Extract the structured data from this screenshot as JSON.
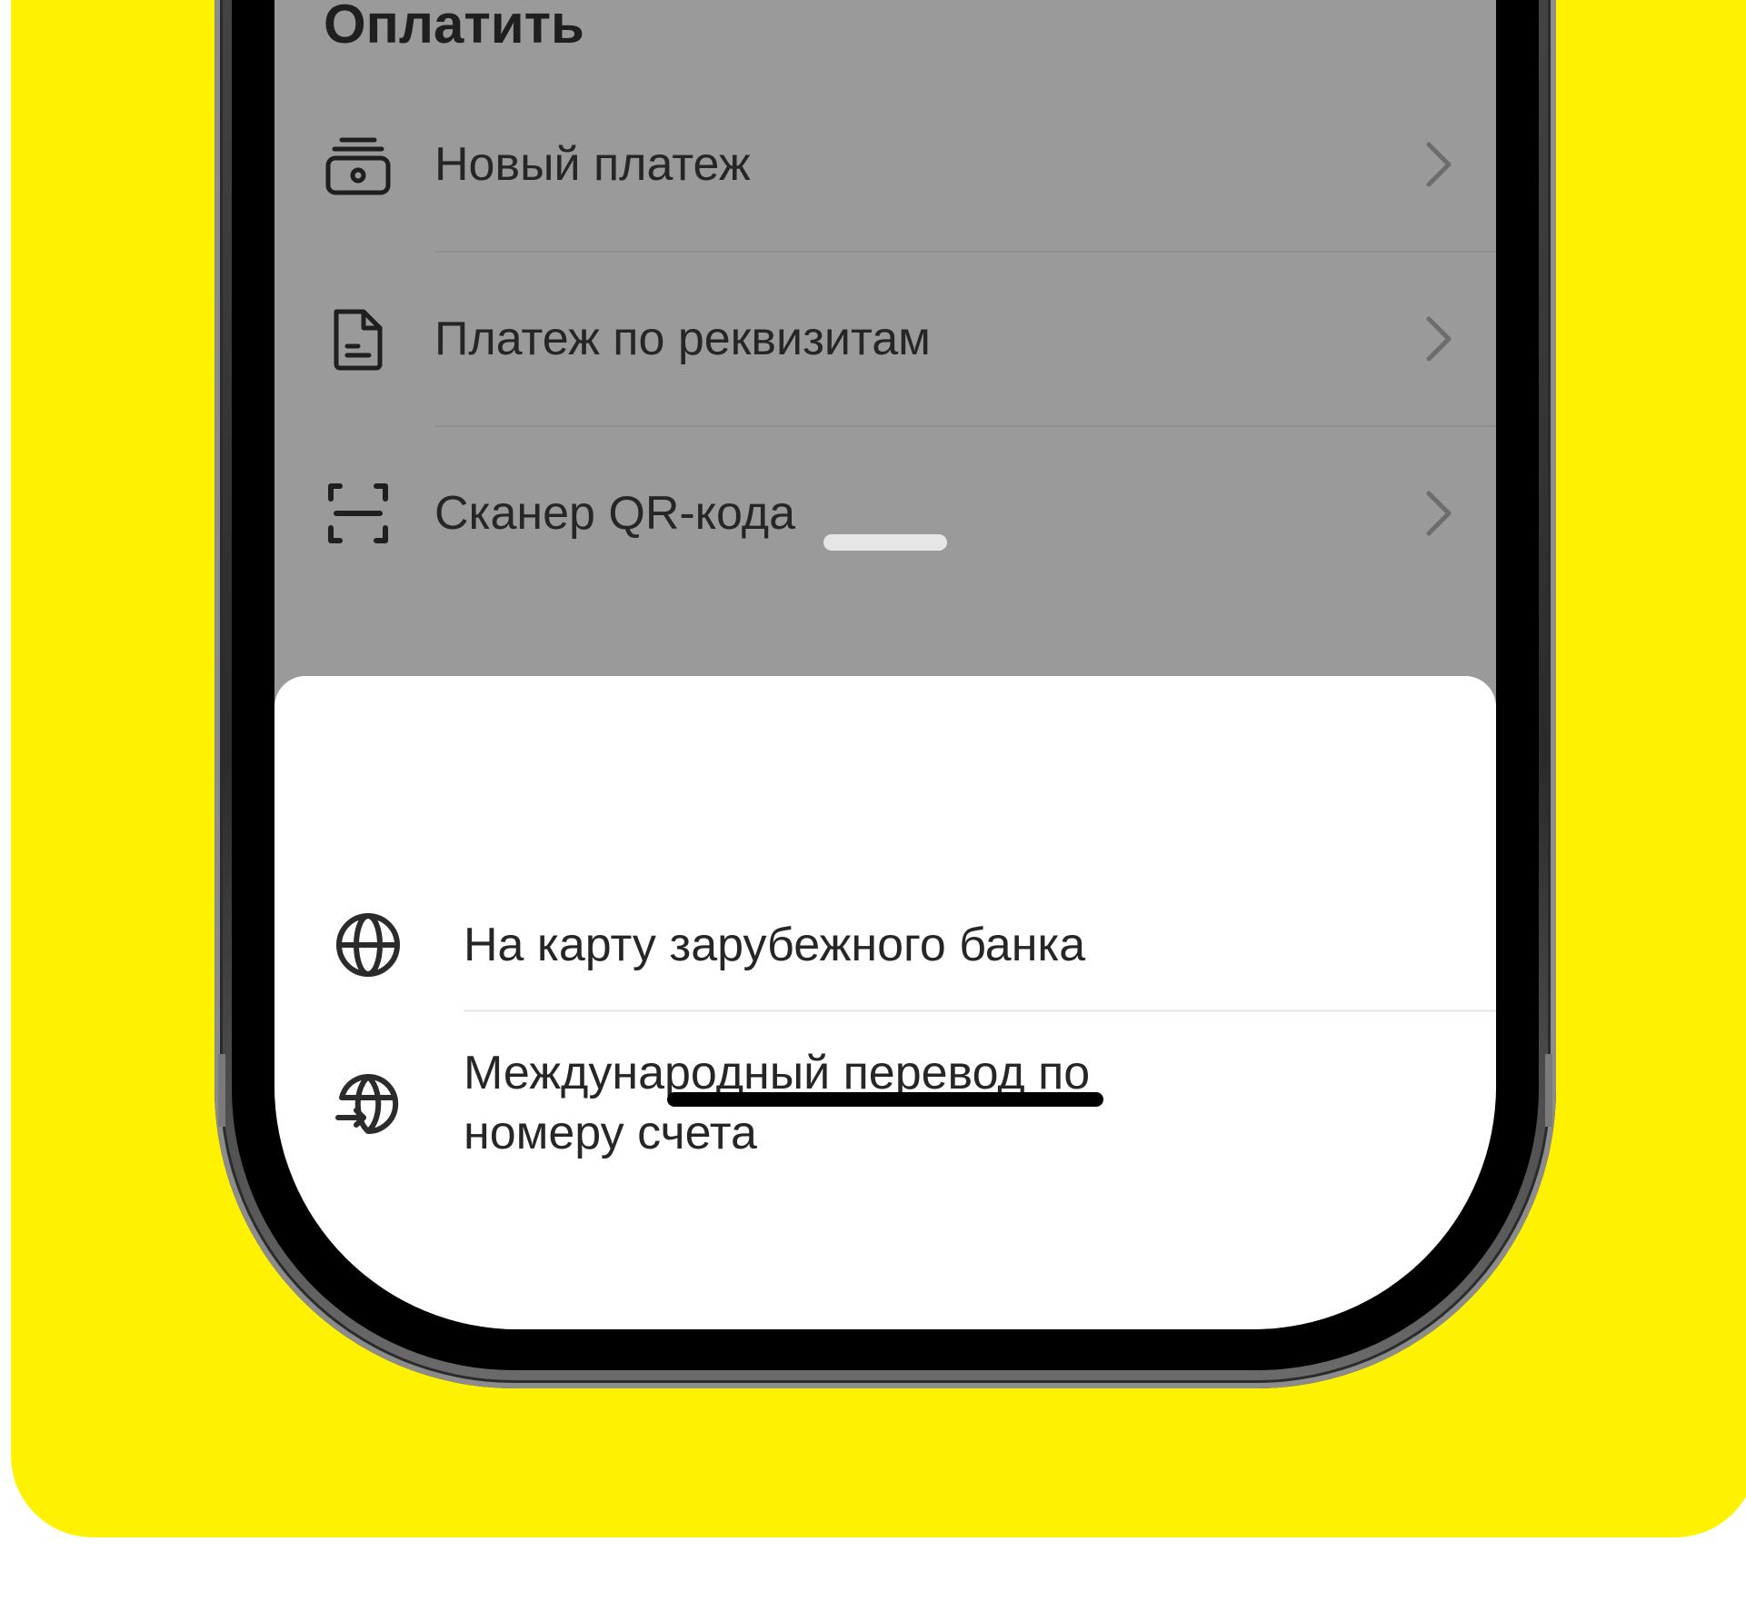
{
  "background": {
    "accent_color": "#FFF200"
  },
  "screen": {
    "title": "Оплатить",
    "menu": [
      {
        "label": "Новый платеж",
        "icon": "wallet-icon"
      },
      {
        "label": "Платеж по реквизитам",
        "icon": "document-icon"
      },
      {
        "label": "Сканер QR-кода",
        "icon": "qr-scanner-icon"
      }
    ]
  },
  "sheet": {
    "items": [
      {
        "label": "На карту зарубежного банка",
        "icon": "globe-icon"
      },
      {
        "label": "Международный перевод по номеру счета",
        "icon": "globe-transfer-icon"
      }
    ]
  }
}
